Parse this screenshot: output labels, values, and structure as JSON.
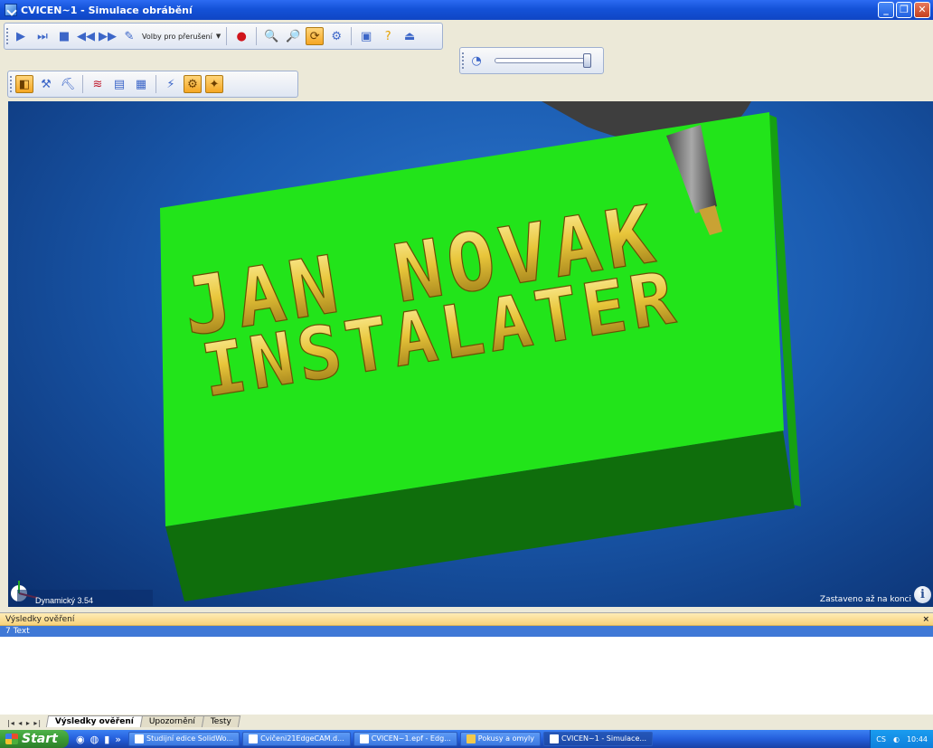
{
  "window": {
    "title": "CVICEN~1 - Simulace obrábění",
    "min_label": "_",
    "max_label": "❐",
    "close_label": "✕"
  },
  "toolbar_main": {
    "interrupt_label": "Volby pro přerušení",
    "icons": [
      "play-icon",
      "step-icon",
      "stop-icon",
      "rewind-icon",
      "forward-icon",
      "options-icon",
      "record-icon",
      "zoom-icon",
      "zoom-out-icon",
      "view-icon",
      "settings-icon",
      "save-icon",
      "help-icon",
      "eject-icon"
    ]
  },
  "viewport": {
    "text_line1": "JAN NOVAK",
    "text_line2": "INSTALATER",
    "status_left": "Dynamický 3.54",
    "status_right": "Zastaveno až na konci",
    "background": "#1a5bb0",
    "stock_color": "#22e41a",
    "engrave_color": "#e8c53a"
  },
  "results": {
    "title": "Výsledky ověření",
    "close_label": "×",
    "rows": [
      {
        "label": "7 Text"
      }
    ]
  },
  "tabs": [
    {
      "label": "Výsledky ověření",
      "active": true
    },
    {
      "label": "Upozornění",
      "active": false
    },
    {
      "label": "Testy",
      "active": false
    }
  ],
  "taskbar": {
    "start_label": "Start",
    "tasks": [
      {
        "label": "Studijní edice SolidWo..."
      },
      {
        "label": "Cvičeni21EdgeCAM.d..."
      },
      {
        "label": "CVICEN~1.epf - Edg..."
      },
      {
        "label": "Pokusy a omyly"
      },
      {
        "label": "CVICEN~1 - Simulace..."
      }
    ],
    "lang": "CS",
    "time": "10:44"
  }
}
